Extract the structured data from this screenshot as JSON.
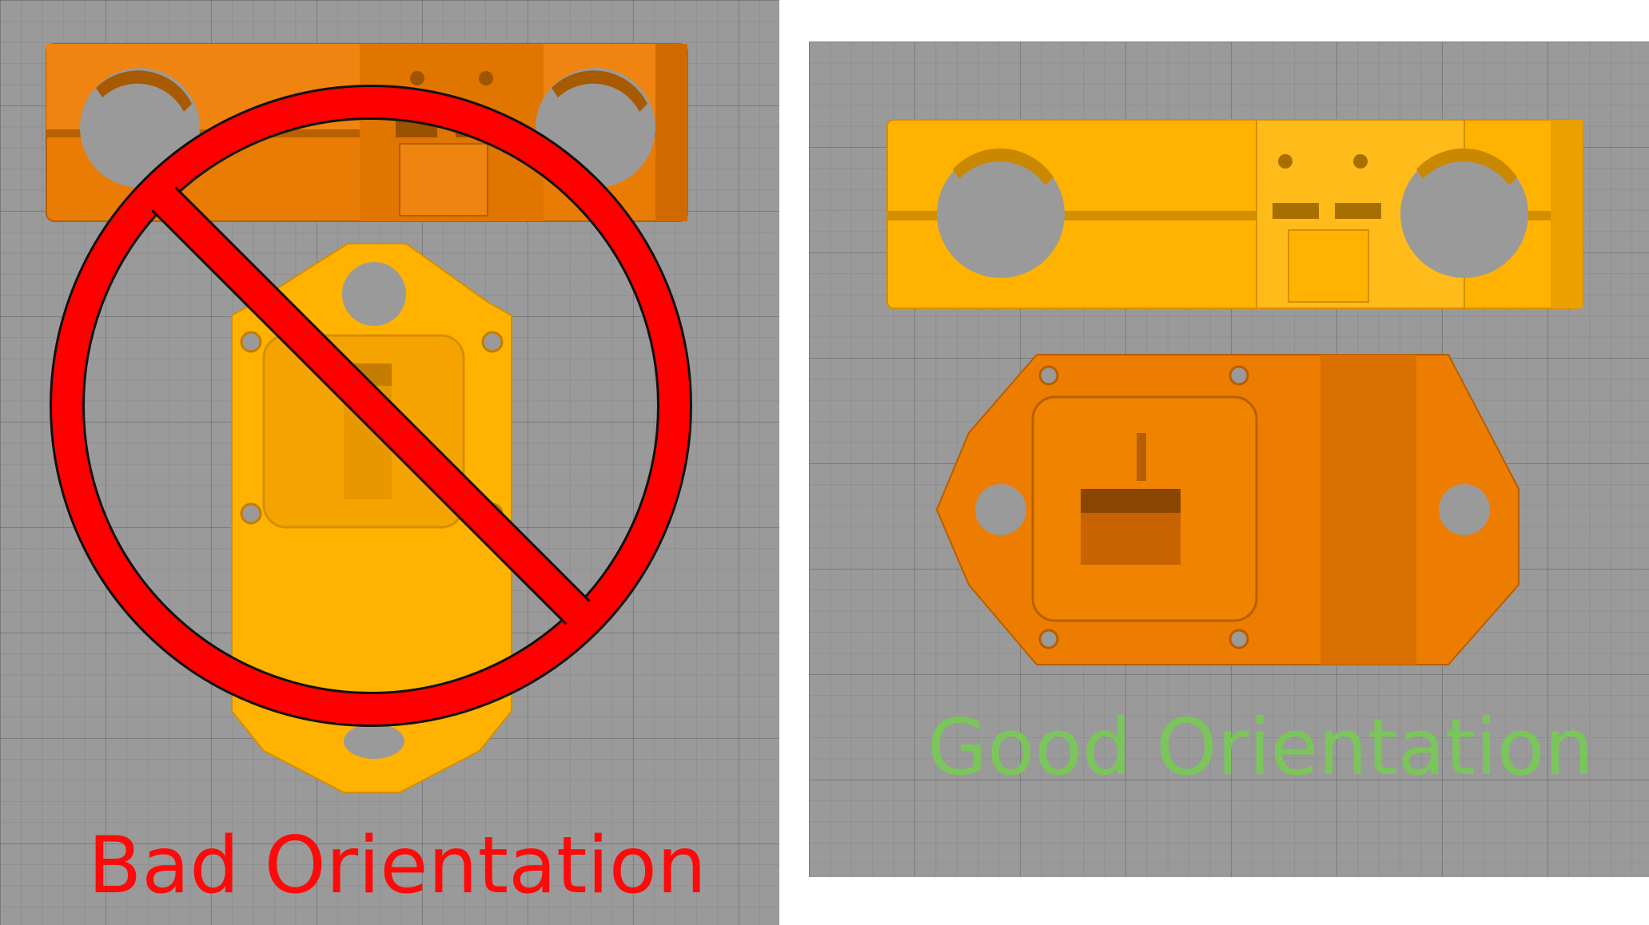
{
  "left_panel": {
    "caption": "Bad Orientation",
    "caption_color": "#ff0a0a",
    "prohibition_sign_color": "#ff0000",
    "part_color_primary": "#ed7d00",
    "part_color_secondary": "#ffb400"
  },
  "right_panel": {
    "caption": "Good Orientation",
    "caption_color": "#7bc65a",
    "part_color_primary": "#ffb400",
    "part_color_secondary": "#ed7d00"
  },
  "background_color": "#9a9a9a"
}
